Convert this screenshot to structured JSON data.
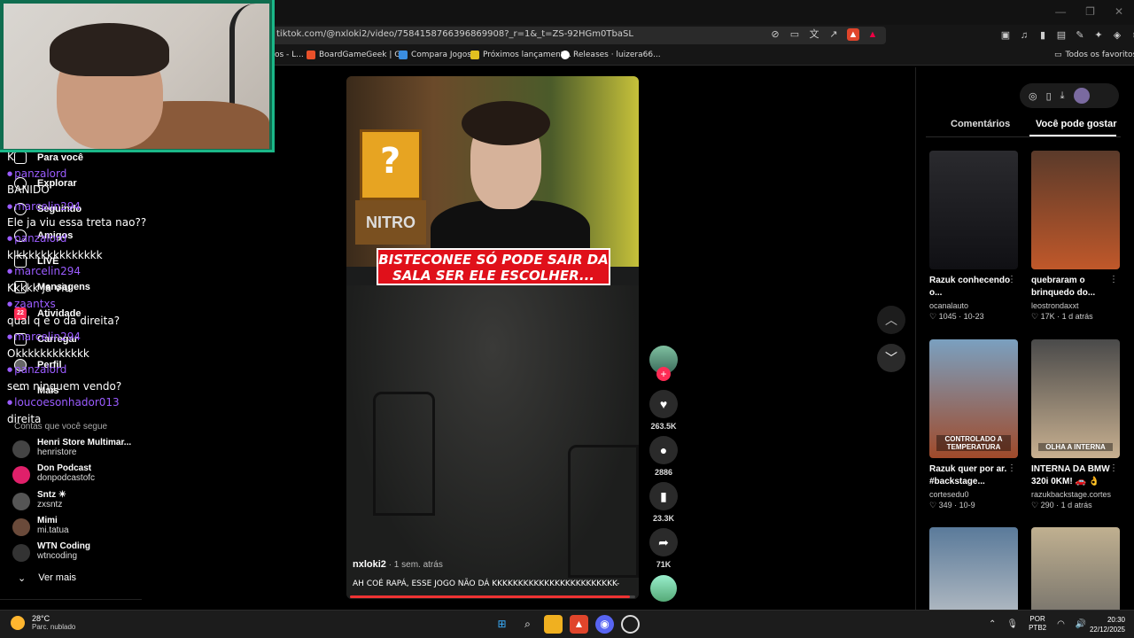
{
  "browser": {
    "url": "tiktok.com/@nxloki2/video/7584158766396869908?_r=1&_t=ZS-92HGm0TbaSL",
    "bookmarks": [
      {
        "label": "os - L...",
        "color": "#888"
      },
      {
        "label": "BoardGameGeek | G...",
        "color": "#e8502a"
      },
      {
        "label": "Compara Jogos",
        "color": "#3a8de0"
      },
      {
        "label": "Próximos lançament...",
        "color": "#e0c020"
      },
      {
        "label": "Releases · luizera66...",
        "color": "#ffffff"
      }
    ],
    "favorites_label": "Todos os favoritos"
  },
  "sidebar": {
    "nav": [
      {
        "label": "Para você"
      },
      {
        "label": "Explorar"
      },
      {
        "label": "Seguindo"
      },
      {
        "label": "Amigos"
      },
      {
        "label": "LIVE"
      },
      {
        "label": "Mensagens"
      },
      {
        "label": "Atividade",
        "badge": "22"
      },
      {
        "label": "Carregar"
      },
      {
        "label": "Perfil"
      },
      {
        "label": "Mais"
      }
    ],
    "following_header": "Contas que você segue",
    "accounts": [
      {
        "name": "Henri Store Multimar...",
        "handle": "henristore",
        "color": "#444"
      },
      {
        "name": "Don Podcast",
        "handle": "donpodcastofc",
        "color": "#e0206a"
      },
      {
        "name": "Sntz ☀",
        "handle": "zxsntz",
        "color": "#555"
      },
      {
        "name": "Mimi",
        "handle": "mi.tatua",
        "color": "#6a4a3a"
      },
      {
        "name": "WTN Coding",
        "handle": "wtncoding",
        "color": "#333"
      }
    ],
    "see_more": "Ver mais"
  },
  "chat": [
    {
      "type": "msg",
      "text": "K"
    },
    {
      "type": "user",
      "text": "panzalord"
    },
    {
      "type": "msg",
      "text": "BANIDO"
    },
    {
      "type": "user",
      "text": "marcelin294"
    },
    {
      "type": "msg",
      "text": "Ele ja viu essa treta nao??"
    },
    {
      "type": "user",
      "text": "panzalord"
    },
    {
      "type": "msg",
      "text": "klkkkkkkkkkkkkkk"
    },
    {
      "type": "user",
      "text": "marcelin294"
    },
    {
      "type": "msg",
      "text": "Kkkkk ja viu"
    },
    {
      "type": "user",
      "text": "zaantxs"
    },
    {
      "type": "msg",
      "text": "qual q é o da direita?"
    },
    {
      "type": "user",
      "text": "marcelin294"
    },
    {
      "type": "msg",
      "text": "Okkkkkkkkkkkk"
    },
    {
      "type": "user",
      "text": "panzalord"
    },
    {
      "type": "msg",
      "text": "sem ninguem vendo?"
    },
    {
      "type": "user",
      "text": "loucoesonhador013"
    },
    {
      "type": "msg",
      "text": "direita"
    }
  ],
  "video": {
    "caption": "BISTECONEE SÓ PODE SAIR DA SALA SER ELE ESCOLHER...",
    "nitro_text": "NITRO",
    "author": "nxloki2",
    "posted": " · 1 sem. atrás",
    "description": "AH COÉ RAPÁ, ESSE JOGO NÃO DÁ KKKKKKKKKKKKKKKKKKKKKKKK-",
    "progress": 0.98
  },
  "actions": {
    "likes": "263.5K",
    "comments": "2886",
    "saves": "23.3K",
    "shares": "71K"
  },
  "right_panel": {
    "tab_comments": "Comentários",
    "tab_suggested": "Você pode gostar",
    "cards": [
      {
        "title": "Razuk conhecendo o...",
        "user": "ocanalauto",
        "likes": "1045",
        "date": "10-23",
        "label": "",
        "bg": "linear-gradient(#2a2a2e,#101014)"
      },
      {
        "title": "quebraram o brinquedo do...",
        "user": "leostrondaxxt",
        "likes": "17K",
        "date": "1 d atrás",
        "label": "",
        "bg": "linear-gradient(#5a3a2a,#c0582a)"
      },
      {
        "title": "Razuk quer por ar. #backstage...",
        "user": "cortesedu0",
        "likes": "349",
        "date": "10-9",
        "label": "CONTROLADO A TEMPERATURA",
        "bg": "linear-gradient(#7aa0c0,#a04a2a)"
      },
      {
        "title": "INTERNA DA BMW 320i 0KM! 🚗 👌",
        "user": "razukbackstage.cortes",
        "likes": "290",
        "date": "1 d atrás",
        "label": "OLHA A INTERNA",
        "bg": "linear-gradient(#4a4a4a,#c8b090)"
      },
      {
        "title": "",
        "user": "",
        "likes": "",
        "date": "",
        "label": "",
        "bg": "linear-gradient(#5a7a9a,#d0d0d0)"
      },
      {
        "title": "",
        "user": "",
        "likes": "",
        "date": "",
        "label": "",
        "bg": "linear-gradient(#c0b090,#606060)"
      }
    ]
  },
  "taskbar": {
    "temp": "28°C",
    "weather": "Parc. nublado",
    "lang_top": "POR",
    "lang_bottom": "PTB2",
    "time": "20:30",
    "date": "22/12/2025"
  }
}
